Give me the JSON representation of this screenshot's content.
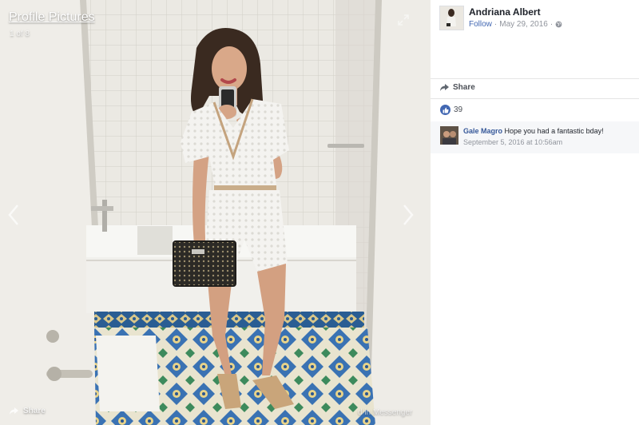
{
  "album": {
    "title": "Profile Pictures",
    "counter": "1 of 8"
  },
  "stage_footer": {
    "share_label": "Share",
    "messenger_label": "d in Messenger"
  },
  "post": {
    "author_name": "Andriana Albert",
    "follow_label": "Follow",
    "separator": "·",
    "date": "May 29, 2016",
    "separator2": "·",
    "privacy_icon": "globe-icon"
  },
  "actions": {
    "share_label": "Share",
    "like_count": "39"
  },
  "comments": [
    {
      "author": "Gale Magro",
      "text": "Hope you had a fantastic bday!",
      "timestamp": "September 5, 2016 at 10:56am"
    }
  ],
  "colors": {
    "link_blue": "#4267b2",
    "name_blue": "#365899",
    "muted_text": "#90949c",
    "tile_blue": "#2f66a8"
  }
}
